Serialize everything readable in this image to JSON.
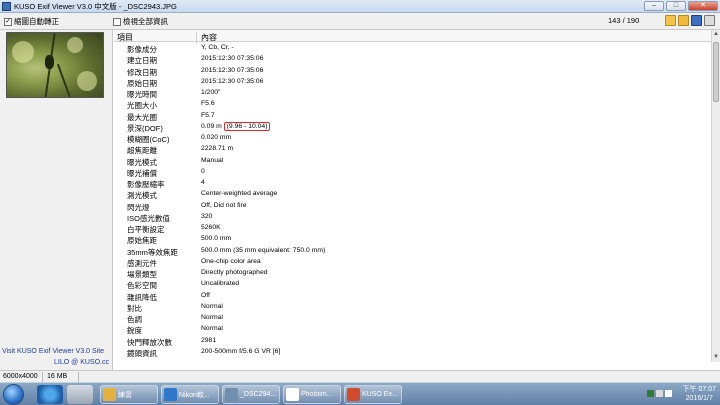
{
  "window": {
    "title": "KUSO Exif Viewer V3.0 中文版 - _DSC2943.JPG",
    "controls": {
      "minimize": "–",
      "maximize": "□",
      "close": "✕"
    }
  },
  "toolbar": {
    "auto_rotate_label": "縮圖自動轉正",
    "auto_rotate_checked": "✓",
    "show_all_label": "檢視全部資訊",
    "counter": "143 / 190",
    "buttons": [
      "open-folder-icon",
      "folder-icon",
      "save-icon",
      "print-icon",
      "help-icon"
    ]
  },
  "left_panel": {
    "link1": "Visit KUSO Exif Viewer V3.0 Site",
    "link2": "LILO @ KUSO.cc"
  },
  "grid": {
    "col_item": "項目",
    "col_content": "內容",
    "rows": [
      {
        "k": "影像成分",
        "v": "Y, Cb, Cr, -"
      },
      {
        "k": "建立日期",
        "v": "2015:12:30 07:35:06"
      },
      {
        "k": "修改日期",
        "v": "2015:12:30 07:35:06"
      },
      {
        "k": "原始日期",
        "v": "2015:12:30 07:35:06"
      },
      {
        "k": "曝光時間",
        "v": "1/200\""
      },
      {
        "k": "光圈大小",
        "v": "F5.6"
      },
      {
        "k": "最大光圈",
        "v": "F5.7"
      },
      {
        "k": "景深(DOF)",
        "v": "0.09 m",
        "extra": "(9.96 - 10.04)"
      },
      {
        "k": "模糊圈(CoC)",
        "v": "0.020 mm"
      },
      {
        "k": "超焦距離",
        "v": "2228.71 m"
      },
      {
        "k": "曝光模式",
        "v": "Manual"
      },
      {
        "k": "曝光補償",
        "v": "0"
      },
      {
        "k": "影像壓縮率",
        "v": "4"
      },
      {
        "k": "測光模式",
        "v": "Center-weighted average"
      },
      {
        "k": "閃光燈",
        "v": "Off, Did not fire"
      },
      {
        "k": "ISO感光數值",
        "v": "320"
      },
      {
        "k": "白平衡設定",
        "v": "5260K"
      },
      {
        "k": "原始焦距",
        "v": "500.0 mm"
      },
      {
        "k": "35mm等效焦距",
        "v": "500.0 mm (35 mm equivalent: 750.0 mm)"
      },
      {
        "k": "感測元件",
        "v": "One-chip color area"
      },
      {
        "k": "場景類型",
        "v": "Directly photographed"
      },
      {
        "k": "色彩空間",
        "v": "Uncalibrated"
      },
      {
        "k": "雜訊降低",
        "v": "Off"
      },
      {
        "k": "對比",
        "v": "Normal"
      },
      {
        "k": "色調",
        "v": "Normal"
      },
      {
        "k": "銳度",
        "v": "Normal"
      },
      {
        "k": "快門釋放次數",
        "v": "2981"
      },
      {
        "k": "鏡頭資訊",
        "v": "200-500mm f/5.6 G VR [6]"
      }
    ]
  },
  "statusbar": {
    "dimensions": "6000x4000",
    "filesize": "16 MB"
  },
  "taskbar": {
    "tasks": [
      {
        "label": "練習",
        "icon": "folder-icon"
      },
      {
        "label": "Nikon軟...",
        "icon": "ie-icon"
      },
      {
        "label": "_DSC294...",
        "icon": "image-icon"
      },
      {
        "label": "Photoim...",
        "icon": "photoimpact-icon"
      },
      {
        "label": "KUSO Ex...",
        "icon": "kuso-icon"
      }
    ],
    "clock_time": "下午 07:07",
    "clock_date": "2016/1/7"
  },
  "colors": {
    "link": "#1b3f9a",
    "highlight_box": "#d0302a",
    "taskbar": "#5f7fa6"
  }
}
